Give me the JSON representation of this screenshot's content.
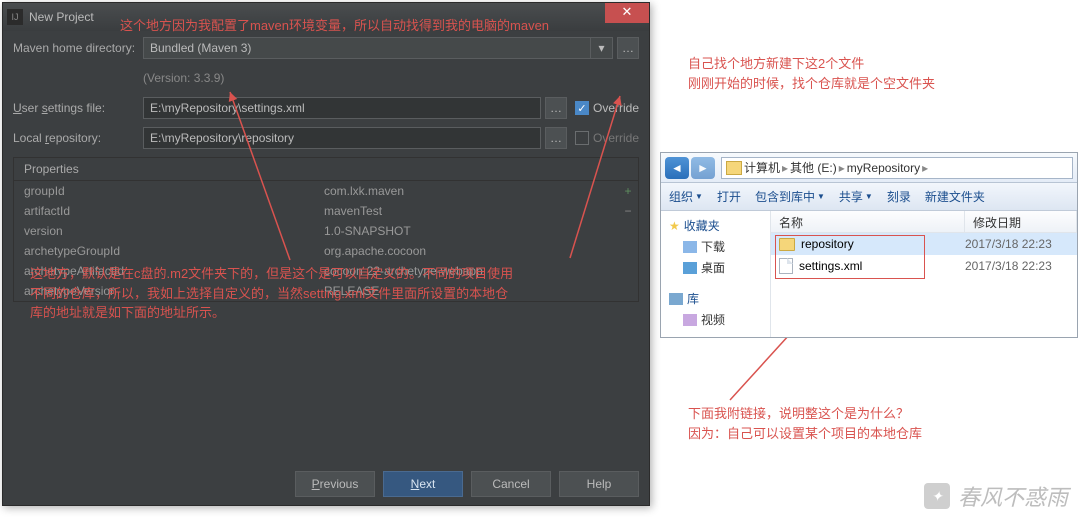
{
  "dialog": {
    "title": "New Project",
    "mavenHomeLabel": "Maven home directory:",
    "mavenHomeValue": "Bundled (Maven 3)",
    "versionNote": "(Version: 3.3.9)",
    "userSettingsLabel": "User settings file:",
    "userSettingsValue": "E:\\myRepository\\settings.xml",
    "localRepoLabel": "Local repository:",
    "localRepoValue": "E:\\myRepository\\repository",
    "overrideLabel": "Override",
    "override1Checked": true,
    "override2Checked": false,
    "propertiesHeader": "Properties",
    "props": [
      {
        "k": "groupId",
        "v": "com.lxk.maven"
      },
      {
        "k": "artifactId",
        "v": "mavenTest"
      },
      {
        "k": "version",
        "v": "1.0-SNAPSHOT"
      },
      {
        "k": "archetypeGroupId",
        "v": "org.apache.cocoon"
      },
      {
        "k": "archetypeArtifactId",
        "v": "cocoon-22-archetype-webapp"
      },
      {
        "k": "archetypeVersion",
        "v": "RELEASE"
      }
    ],
    "buttons": {
      "previous": "Previous",
      "next": "Next",
      "cancel": "Cancel",
      "help": "Help"
    }
  },
  "annotations": {
    "top": "这个地方因为我配置了maven环境变量，所以自动找得到我的电脑的maven",
    "mid": "这地方，默认是在c盘的.m2文件夹下的，但是这个是可以自定义的。不同的项目使用\n不同的仓库，所以，我如上选择自定义的，当然setting.xml文件里面所设置的本地仓\n库的地址就是如下面的地址所示。",
    "right1": "自己找个地方新建下这2个文件\n刚刚开始的时候，找个仓库就是个空文件夹",
    "right2": "下面我附链接，说明整这个是为什么？\n因为：自己可以设置某个项目的本地仓库"
  },
  "explorer": {
    "breadcrumb": [
      "计算机",
      "其他 (E:)",
      "myRepository"
    ],
    "toolbar": {
      "org": "组织",
      "open": "打开",
      "lib": "包含到库中",
      "share": "共享",
      "burn": "刻录",
      "newfolder": "新建文件夹"
    },
    "sidebar": {
      "fav": "收藏夹",
      "downloads": "下载",
      "desktop": "桌面",
      "lib": "库",
      "video": "视频"
    },
    "columns": {
      "name": "名称",
      "date": "修改日期"
    },
    "rows": [
      {
        "name": "repository",
        "type": "folder",
        "date": "2017/3/18 22:23",
        "selected": true
      },
      {
        "name": "settings.xml",
        "type": "file",
        "date": "2017/3/18 22:23",
        "selected": false
      }
    ]
  },
  "watermark": "春风不惑雨"
}
